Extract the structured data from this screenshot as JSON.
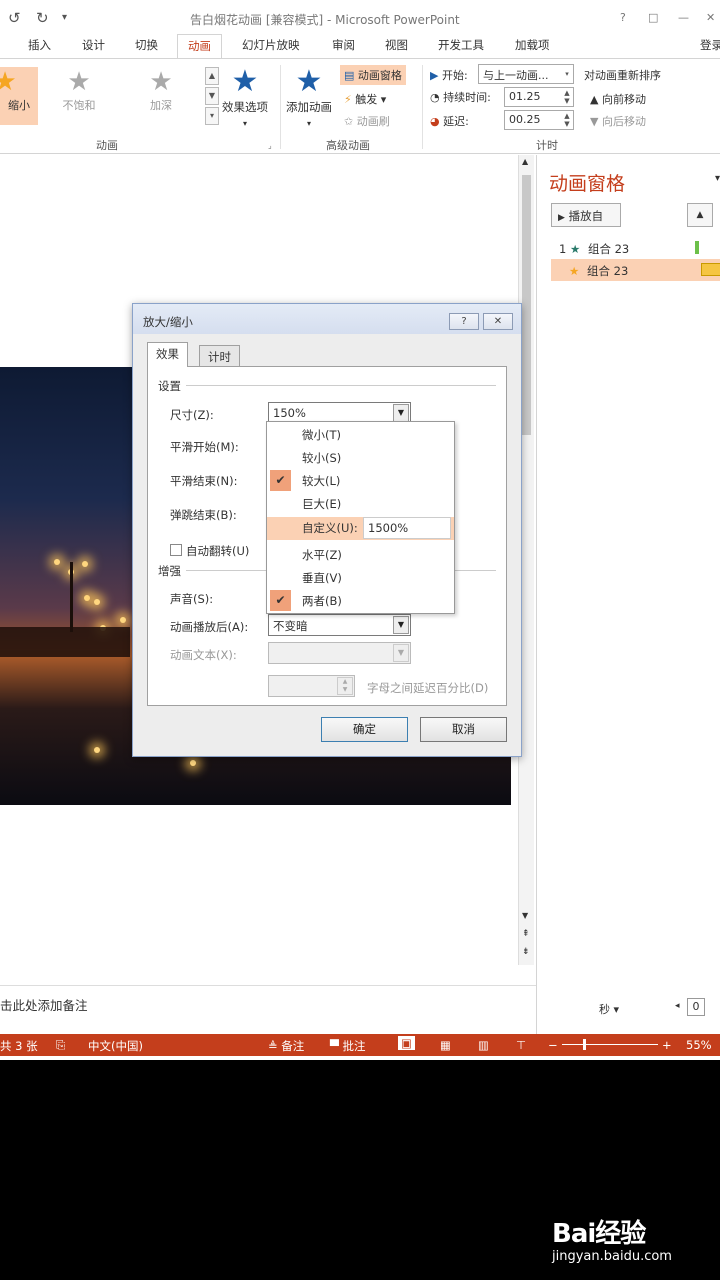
{
  "window": {
    "title": "告白烟花动画 [兼容模式] - Microsoft PowerPoint",
    "controls": [
      "?",
      "□",
      "—",
      "✕"
    ]
  },
  "tabs": [
    "插入",
    "设计",
    "切换",
    "动画",
    "幻灯片放映",
    "审阅",
    "视图",
    "开发工具",
    "加载项"
  ],
  "account": "登录",
  "ribbon": {
    "gallery": [
      "缩小",
      "不饱和",
      "加深"
    ],
    "effect_options": "效果选项",
    "group_animation": "动画",
    "add_animation": "添加动画",
    "animation_pane": "动画窗格",
    "trigger": "触发",
    "animation_painter": "动画刷",
    "group_advanced": "高级动画",
    "start_label": "开始:",
    "start_value": "与上一动画...",
    "duration_label": "持续时间:",
    "duration_value": "01.25",
    "delay_label": "延迟:",
    "delay_value": "00.25",
    "group_timing": "计时",
    "reorder_title": "对动画重新排序",
    "move_earlier": "向前移动",
    "move_later": "向后移动"
  },
  "pane": {
    "title": "动画窗格",
    "play_from": "播放自",
    "items": [
      {
        "index": "1",
        "name": "组合 23"
      },
      {
        "index": "",
        "name": "组合 23"
      }
    ],
    "seconds": "秒",
    "zoom_value": "0"
  },
  "notes": {
    "placeholder": "击此处添加备注"
  },
  "status": {
    "slides": "共 3 张",
    "language": "中文(中国)",
    "notes": "备注",
    "comments": "批注",
    "zoom": "55%"
  },
  "dialog": {
    "title": "放大/缩小",
    "help": "?",
    "close": "✕",
    "tabs": [
      "效果",
      "计时"
    ],
    "section_settings": "设置",
    "size_label": "尺寸(Z):",
    "size_value": "150%",
    "smooth_start": "平滑开始(M):",
    "smooth_end": "平滑结束(N):",
    "bounce_end": "弹跳结束(B):",
    "auto_reverse": "自动翻转(U)",
    "section_enhance": "增强",
    "sound_label": "声音(S):",
    "after_label": "动画播放后(A):",
    "after_value": "不变暗",
    "text_label": "动画文本(X):",
    "delay_letters": "字母之间延迟百分比(D)",
    "ok": "确定",
    "cancel": "取消"
  },
  "size_menu": {
    "options": [
      "微小(T)",
      "较小(S)",
      "较大(L)",
      "巨大(E)",
      "自定义(U):",
      "水平(Z)",
      "垂直(V)",
      "两者(B)"
    ],
    "custom_value": "1500%"
  },
  "watermark": {
    "logo": "Bai经验",
    "url": "jingyan.baidu.com"
  }
}
